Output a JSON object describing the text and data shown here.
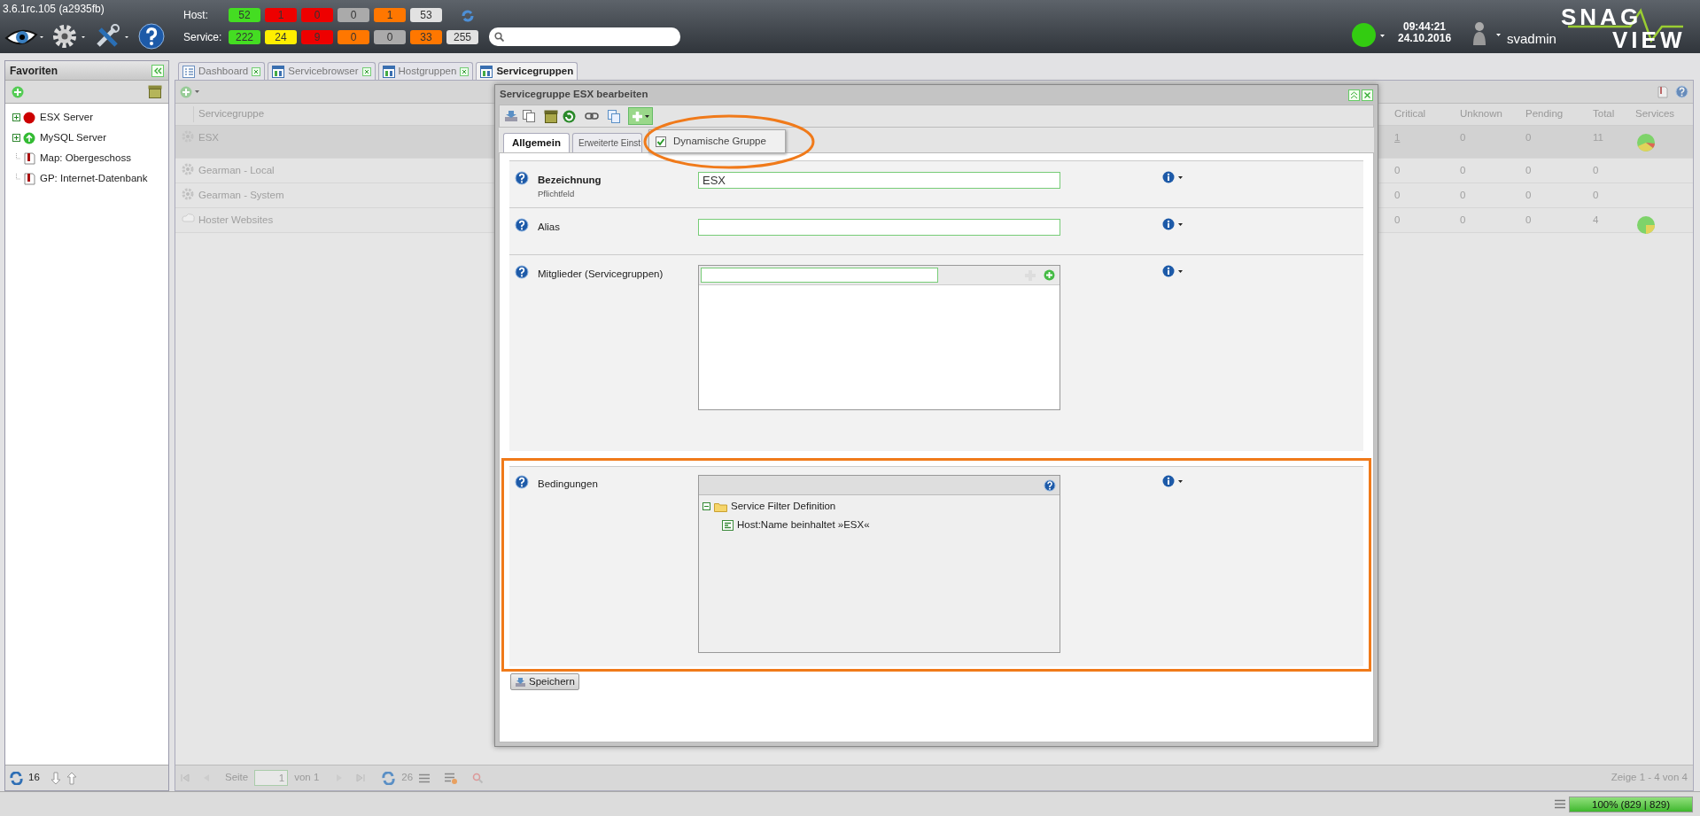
{
  "version": "3.6.1rc.105 (a2935fb)",
  "header": {
    "host_label": "Host:",
    "service_label": "Service:",
    "host_counters": [
      {
        "value": "52",
        "color": "#44dd22"
      },
      {
        "value": "1",
        "color": "#ee0000"
      },
      {
        "value": "0",
        "color": "#ee0000"
      },
      {
        "value": "0",
        "color": "#aaaaaa"
      },
      {
        "value": "1",
        "color": "#ff7700"
      },
      {
        "value": "53",
        "color": "#e2e2e2"
      }
    ],
    "service_counters": [
      {
        "value": "222",
        "color": "#44dd22"
      },
      {
        "value": "24",
        "color": "#ffee00"
      },
      {
        "value": "9",
        "color": "#ee0000"
      },
      {
        "value": "0",
        "color": "#ff7700"
      },
      {
        "value": "0",
        "color": "#aaaaaa"
      },
      {
        "value": "33",
        "color": "#ff7700"
      },
      {
        "value": "255",
        "color": "#e2e2e2"
      }
    ],
    "time": "09:44:21",
    "date": "24.10.2016",
    "user": "svadmin",
    "logo_top": "SNAG",
    "logo_bottom": "VIEW"
  },
  "sidebar": {
    "title": "Favoriten",
    "items": [
      {
        "label": "ESX Server",
        "kind": "host-down",
        "expanded": false
      },
      {
        "label": "MySQL Server",
        "kind": "host-up",
        "expanded": false
      },
      {
        "label": "Map: Obergeschoss",
        "kind": "map"
      },
      {
        "label": "GP: Internet-Datenbank",
        "kind": "map"
      }
    ],
    "refresh_count": "16"
  },
  "tabs": [
    {
      "label": "Dashboard",
      "kind": "dashboard",
      "selected": false
    },
    {
      "label": "Servicebrowser",
      "kind": "grid",
      "selected": false
    },
    {
      "label": "Hostgruppen",
      "kind": "grid",
      "selected": false
    },
    {
      "label": "Servicegruppen",
      "kind": "grid",
      "selected": true
    }
  ],
  "table": {
    "first_column": "Servicegruppe",
    "columns": [
      "Critical",
      "Unknown",
      "Pending",
      "Total",
      "Services"
    ],
    "rows": [
      {
        "name": "ESX",
        "kind": "gear",
        "selected": true,
        "cells": [
          "1",
          "0",
          "0",
          "11"
        ],
        "services": {
          "kind": "ok-warning-critical"
        }
      },
      {
        "name": "Gearman - Local",
        "kind": "gear",
        "selected": false,
        "cells": [
          "0",
          "0",
          "0",
          "0"
        ]
      },
      {
        "name": "Gearman - System",
        "kind": "gear",
        "selected": false,
        "cells": [
          "0",
          "0",
          "0",
          "0"
        ]
      },
      {
        "name": "Hoster Websites",
        "kind": "cloud",
        "selected": false,
        "cells": [
          "0",
          "0",
          "0",
          "4"
        ],
        "services": {
          "kind": "ok-warning"
        }
      }
    ]
  },
  "pager": {
    "page_label": "Seite",
    "page": "1",
    "of": "von 1",
    "refresh_count": "26",
    "summary": "Zeige 1 - 4 von 4"
  },
  "status_bar": {
    "level": 1,
    "reading": "100% (829 | 829)"
  },
  "dialog": {
    "title": "Servicegruppe ESX bearbeiten",
    "menu": {
      "label": "Dynamische Gruppe",
      "checked": true,
      "highlighted": true
    },
    "tabs": [
      {
        "label": "Allgemein",
        "selected": true
      },
      {
        "label": "Erweiterte Einst",
        "selected": false
      }
    ],
    "fields": [
      {
        "kind": "text",
        "label": "Bezeichnung",
        "sublabel": "Pflichtfeld",
        "value": "ESX"
      },
      {
        "kind": "text",
        "label": "Alias"
      },
      {
        "kind": "list",
        "label": "Mitglieder (Servicegruppen)"
      },
      {
        "kind": "tree",
        "label": "Bedingungen",
        "highlighted": true,
        "tree": [
          {
            "label": "Service Filter Definition",
            "expanded": true,
            "children": [
              {
                "label": "Host:Name beinhaltet »ESX«"
              }
            ]
          }
        ]
      }
    ],
    "save": "Speichern"
  }
}
